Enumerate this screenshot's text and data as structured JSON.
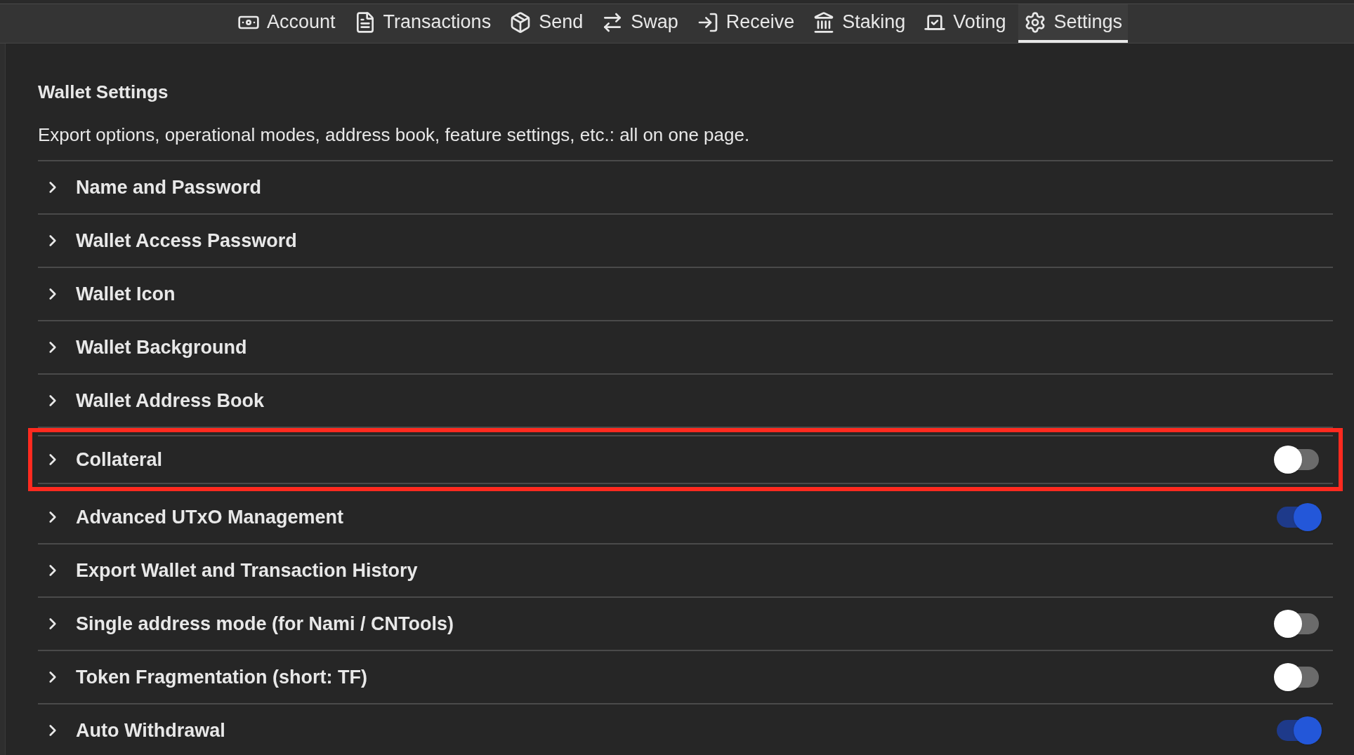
{
  "nav": [
    {
      "label": "Account",
      "selected": false
    },
    {
      "label": "Transactions",
      "selected": false
    },
    {
      "label": "Send",
      "selected": false
    },
    {
      "label": "Swap",
      "selected": false
    },
    {
      "label": "Receive",
      "selected": false
    },
    {
      "label": "Staking",
      "selected": false
    },
    {
      "label": "Voting",
      "selected": false
    },
    {
      "label": "Settings",
      "selected": true
    }
  ],
  "page": {
    "title": "Wallet Settings",
    "description": "Export options, operational modes, address book, feature settings, etc.: all on one page."
  },
  "sections": [
    {
      "title": "Name and Password",
      "expanded": false,
      "highlighted": false
    },
    {
      "title": "Wallet Access Password",
      "expanded": false,
      "highlighted": false
    },
    {
      "title": "Wallet Icon",
      "expanded": false,
      "highlighted": false
    },
    {
      "title": "Wallet Background",
      "expanded": false,
      "highlighted": false
    },
    {
      "title": "Wallet Address Book",
      "expanded": false,
      "highlighted": false
    },
    {
      "title": "Collateral",
      "expanded": false,
      "highlighted": true,
      "on": false
    },
    {
      "title": "Advanced UTxO Management",
      "expanded": false,
      "highlighted": false,
      "on": true
    },
    {
      "title": "Export Wallet and Transaction History",
      "expanded": false,
      "highlighted": false
    },
    {
      "title": "Single address mode (for Nami / CNTools)",
      "expanded": false,
      "highlighted": false,
      "on": false
    },
    {
      "title": "Token Fragmentation (short: TF)",
      "expanded": false,
      "highlighted": false,
      "on": false
    },
    {
      "title": "Auto Withdrawal",
      "expanded": false,
      "highlighted": false,
      "on": true
    }
  ]
}
